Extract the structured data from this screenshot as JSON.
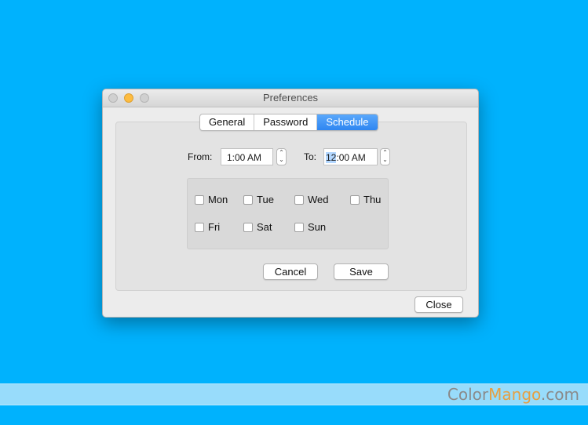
{
  "window": {
    "title": "Preferences"
  },
  "tabs": [
    {
      "label": "General",
      "active": false
    },
    {
      "label": "Password",
      "active": false
    },
    {
      "label": "Schedule",
      "active": true
    }
  ],
  "schedule": {
    "from_label": "From:",
    "from_value": "1:00 AM",
    "to_label": "To:",
    "to_value_selected": "12",
    "to_value_rest": ":00 AM",
    "days": [
      {
        "label": "Mon",
        "checked": false
      },
      {
        "label": "Tue",
        "checked": false
      },
      {
        "label": "Wed",
        "checked": false
      },
      {
        "label": "Thu",
        "checked": false
      },
      {
        "label": "Fri",
        "checked": false
      },
      {
        "label": "Sat",
        "checked": false
      },
      {
        "label": "Sun",
        "checked": false
      }
    ],
    "cancel_label": "Cancel",
    "save_label": "Save"
  },
  "close_label": "Close",
  "watermark": {
    "part1": "Color",
    "part2": "Mango",
    "part3": ".com"
  },
  "colors": {
    "desktop": "#00b2fd",
    "accent": "#2f86f1",
    "minimize": "#fdbc40"
  }
}
